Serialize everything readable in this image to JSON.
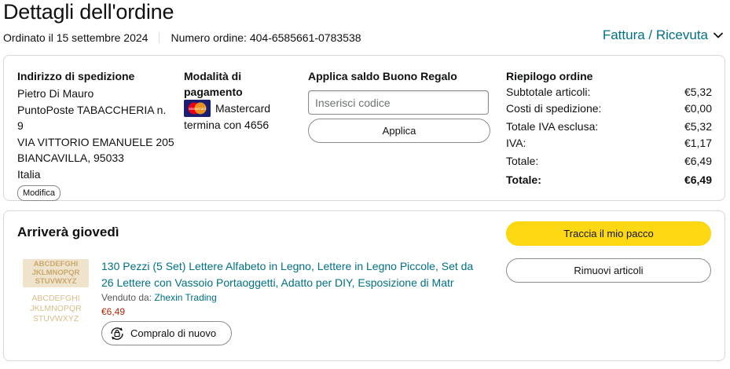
{
  "page": {
    "title": "Dettagli dell'ordine",
    "order_date": "Ordinato il 15 settembre 2024",
    "order_number": "Numero ordine: 404-6585661-0783538",
    "invoice_link": "Fattura / Ricevuta"
  },
  "shipping": {
    "heading": "Indirizzo di spedizione",
    "lines": [
      "Pietro Di Mauro",
      "PuntoPoste TABACCHERIA n. 9",
      "VIA VITTORIO EMANUELE 205",
      "BIANCAVILLA, 95033",
      "Italia"
    ],
    "edit_label": "Modifica"
  },
  "payment": {
    "heading_1": "Modalità di",
    "heading_2": "pagamento",
    "card_name": "Mastercard",
    "card_end": "termina con 4656",
    "logo_text": "MasterCard"
  },
  "gift": {
    "heading": "Applica saldo Buono Regalo",
    "placeholder": "Inserisci codice",
    "apply_label": "Applica"
  },
  "summary": {
    "heading": "Riepilogo ordine",
    "rows": [
      {
        "label": "Subtotale articoli:",
        "value": "€5,32"
      },
      {
        "label": "Costi di spedizione:",
        "value": "€0,00"
      },
      {
        "label": "Totale IVA esclusa:",
        "value": "€5,32"
      },
      {
        "label": "IVA:",
        "value": "€1,17"
      },
      {
        "label": "Totale:",
        "value": "€6,49"
      },
      {
        "label": "Totale:",
        "value": "€6,49"
      }
    ]
  },
  "shipment": {
    "arrival": "Arriverà giovedì",
    "track_label": "Traccia il mio pacco",
    "remove_label": "Rimuovi articoli",
    "product": {
      "title": "130 Pezzi (5 Set) Lettere Alfabeto in Legno, Lettere in Legno Piccole, Set da 26 Lettere con Vassoio Portaoggetti, Adatto per DIY, Esposizione di Matr",
      "sold_by_label": "Venduto da:",
      "seller": "Zhexin Trading",
      "price": "€6,49",
      "buy_again_label": "Compralo di nuovo",
      "thumb_rows": [
        "ABCDEFGHI",
        "JKLMNOPQR",
        "STUVWXYZ",
        "ABCDEFGHI",
        "JKLMNOPQR",
        "STUVWXYZ"
      ]
    }
  },
  "colors": {
    "link": "#007185",
    "price": "#b12704",
    "primary_button": "#ffd814",
    "border": "#d5d9d9"
  }
}
